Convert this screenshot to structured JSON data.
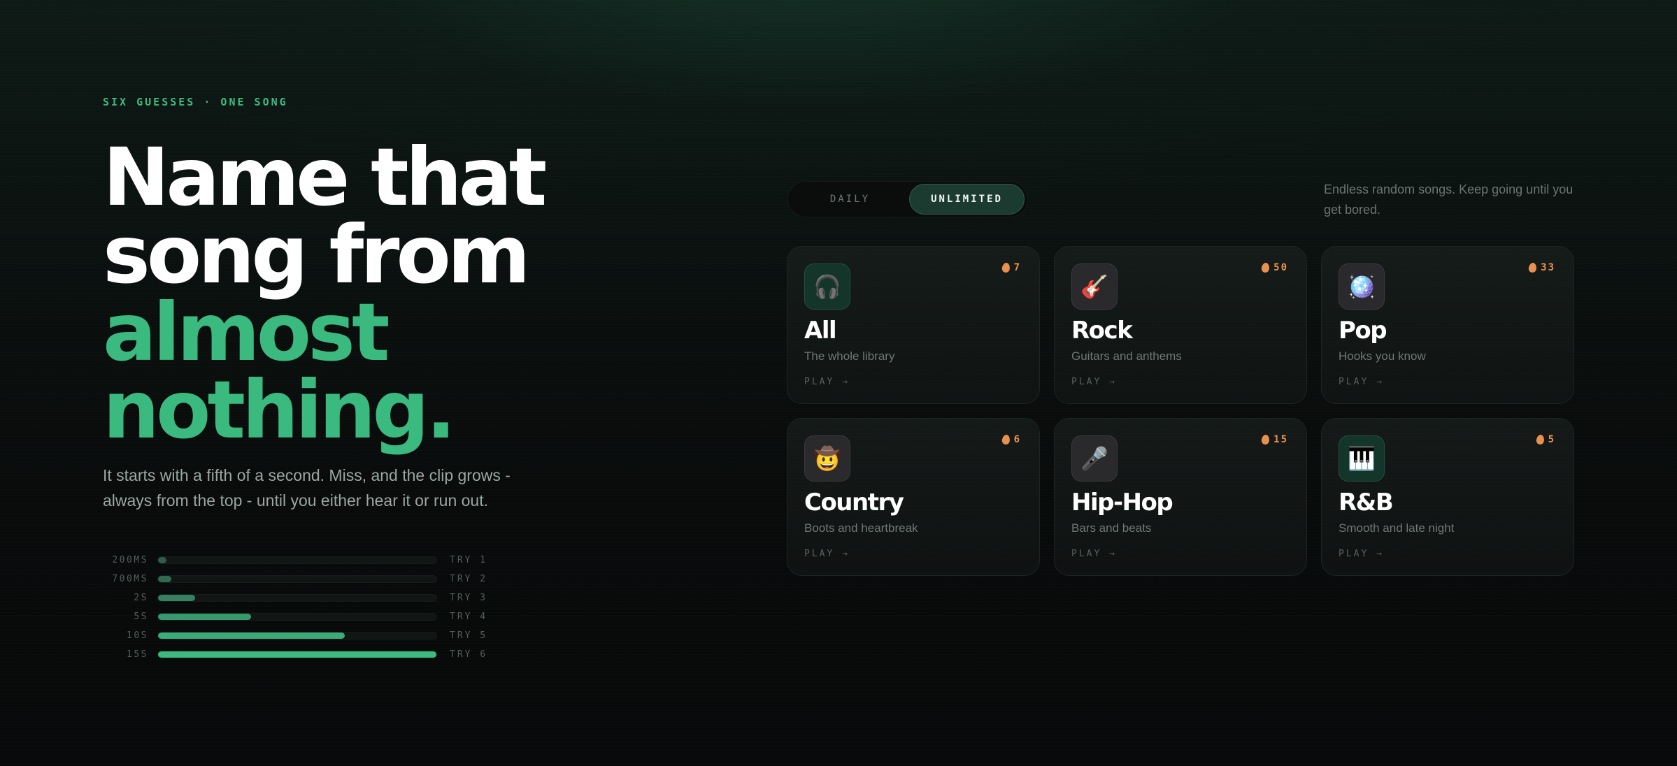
{
  "hero": {
    "eyebrow": "SIX GUESSES · ONE SONG",
    "headline_line1": "Name that",
    "headline_line2": "song from",
    "headline_line3": "almost",
    "headline_line4": "nothing.",
    "lede": "It starts with a fifth of a second. Miss, and the clip grows - always from the top - until you either hear it or run out."
  },
  "clips": [
    {
      "label": "200MS",
      "try": "TRY 1",
      "fill_fraction": 0.013,
      "color": "#2b5e49"
    },
    {
      "label": "700MS",
      "try": "TRY 2",
      "fill_fraction": 0.047,
      "color": "#2f6a51"
    },
    {
      "label": "2S",
      "try": "TRY 3",
      "fill_fraction": 0.133,
      "color": "#34805f"
    },
    {
      "label": "5S",
      "try": "TRY 4",
      "fill_fraction": 0.333,
      "color": "#38996d"
    },
    {
      "label": "10S",
      "try": "TRY 5",
      "fill_fraction": 0.667,
      "color": "#3aac77"
    },
    {
      "label": "15S",
      "try": "TRY 6",
      "fill_fraction": 1.0,
      "color": "#3cba7f"
    }
  ],
  "mode": {
    "daily_label": "DAILY",
    "unlimited_label": "UNLIMITED",
    "selected": "UNLIMITED",
    "description": "Endless random songs. Keep going until you get bored."
  },
  "genres": [
    {
      "title": "All",
      "subtitle": "The whole library",
      "play": "PLAY →",
      "streak": "7",
      "icon": "headphones-icon",
      "glyph": "🎧",
      "tint": "green"
    },
    {
      "title": "Rock",
      "subtitle": "Guitars and anthems",
      "play": "PLAY →",
      "streak": "50",
      "icon": "guitar-icon",
      "glyph": "🎸",
      "tint": "gray"
    },
    {
      "title": "Pop",
      "subtitle": "Hooks you know",
      "play": "PLAY →",
      "streak": "33",
      "icon": "disco-ball-icon",
      "glyph": "🪩",
      "tint": "gray"
    },
    {
      "title": "Country",
      "subtitle": "Boots and heartbreak",
      "play": "PLAY →",
      "streak": "6",
      "icon": "cowboy-face-icon",
      "glyph": "🤠",
      "tint": "gray"
    },
    {
      "title": "Hip-Hop",
      "subtitle": "Bars and beats",
      "play": "PLAY →",
      "streak": "15",
      "icon": "microphone-icon",
      "glyph": "🎤",
      "tint": "gray"
    },
    {
      "title": "R&B",
      "subtitle": "Smooth and late night",
      "play": "PLAY →",
      "streak": "5",
      "icon": "piano-icon",
      "glyph": "🎹",
      "tint": "green"
    }
  ],
  "colors": {
    "accent": "#3aba7e",
    "streak": "#e8914e",
    "background": "#090b0b"
  }
}
